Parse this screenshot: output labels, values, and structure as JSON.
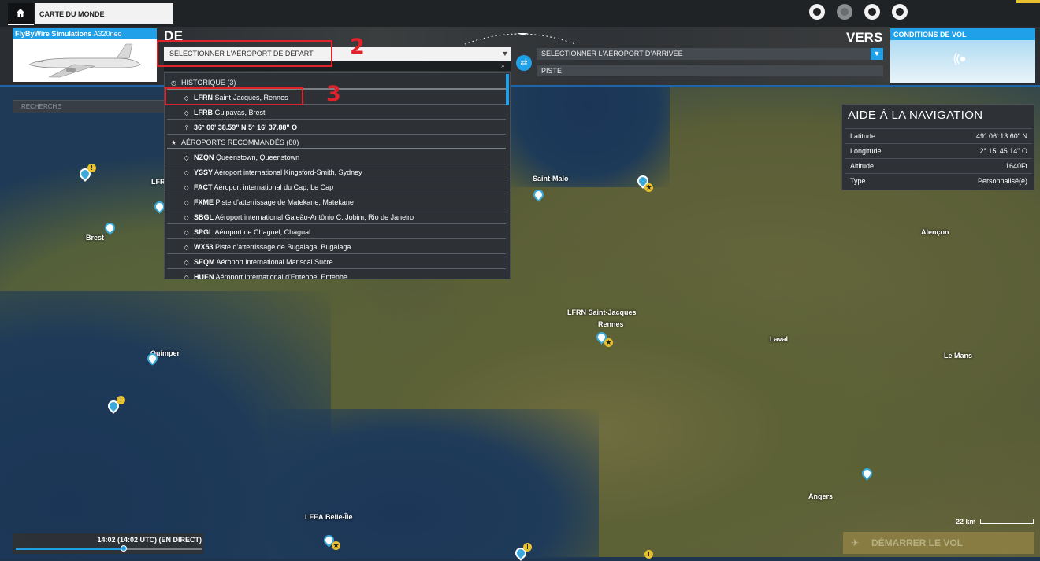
{
  "topbar": {
    "tab_label": "CARTE DU MONDE"
  },
  "aircraft": {
    "brand": "FlyByWire Simulations",
    "model": "A320neo"
  },
  "route": {
    "from_label": "DE",
    "to_label": "VERS",
    "departure_placeholder": "SÉLECTIONNER L'AÉROPORT DE DÉPART",
    "arrival_placeholder": "SÉLECTIONNER L'AÉROPORT D'ARRIVÉE",
    "runway_label": "PISTE"
  },
  "weather": {
    "title": "CONDITIONS DE VOL"
  },
  "search": {
    "placeholder": "RECHERCHE"
  },
  "dropdown": {
    "history_header": "HISTORIQUE (3)",
    "history": [
      {
        "code": "LFRN",
        "name": "Saint-Jacques, Rennes"
      },
      {
        "code": "LFRB",
        "name": "Guipavas, Brest"
      }
    ],
    "coordinate": "36° 00' 38.59\" N 5° 16' 37.88\" O",
    "recommended_header": "AÉROPORTS RECOMMANDÉS (80)",
    "recommended": [
      {
        "code": "NZQN",
        "name": "Queenstown, Queenstown"
      },
      {
        "code": "YSSY",
        "name": "Aéroport international Kingsford-Smith, Sydney"
      },
      {
        "code": "FACT",
        "name": "Aéroport international du Cap, Le Cap"
      },
      {
        "code": "FXME",
        "name": "Piste d'atterrissage de Matekane, Matekane"
      },
      {
        "code": "SBGL",
        "name": "Aéroport international Galeão-Antônio C. Jobim, Rio de Janeiro"
      },
      {
        "code": "SPGL",
        "name": "Aéroport de Chaguel, Chagual"
      },
      {
        "code": "WX53",
        "name": "Piste d'atterrissage de Bugalaga, Bugalaga"
      },
      {
        "code": "SEQM",
        "name": "Aéroport international Mariscal Sucre"
      },
      {
        "code": "HUEN",
        "name": "Aéroport international d'Entebbe, Entebbe"
      }
    ]
  },
  "annotations": {
    "step_2": "2",
    "step_3": "3"
  },
  "nav_aid": {
    "title": "AIDE À LA NAVIGATION",
    "rows": [
      {
        "key": "Latitude",
        "value": "49° 06' 13.60\" N"
      },
      {
        "key": "Longitude",
        "value": "2° 15' 45.14\" O"
      },
      {
        "key": "Altitude",
        "value": "1640Ft"
      },
      {
        "key": "Type",
        "value": "Personnalisé(e)"
      }
    ]
  },
  "map": {
    "cities": {
      "saint_malo": "Saint-Malo",
      "alencon": "Alençon",
      "brest": "Brest",
      "lfr_partial": "LFR",
      "rennes_code": "LFRN",
      "rennes_name": "Saint-Jacques",
      "rennes_city": "Rennes",
      "laval": "Laval",
      "le_mans": "Le Mans",
      "quimper": "Quimper",
      "angers": "Angers",
      "belle_ile_code": "LFEA",
      "belle_ile_name": "Belle-Île"
    },
    "scale": "22 km"
  },
  "time": {
    "label": "14:02 (14:02 UTC) (EN DIRECT)",
    "progress": 0.58
  },
  "actions": {
    "start_flight": "DÉMARRER LE VOL"
  },
  "colors": {
    "accent": "#20a0e8",
    "annotation": "#e0222a",
    "start_button": "#8c7f43"
  }
}
